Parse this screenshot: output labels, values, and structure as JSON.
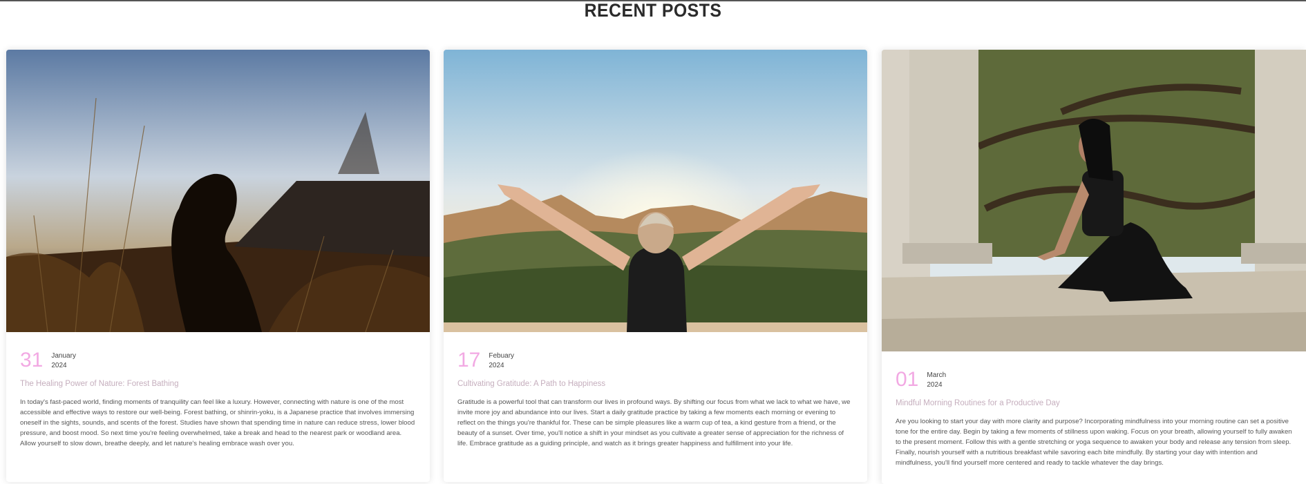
{
  "section": {
    "title": "RECENT POSTS"
  },
  "posts": [
    {
      "day": "31",
      "month": "January",
      "year": "2024",
      "title": "The Healing Power of Nature: Forest Bathing",
      "excerpt": "In today's fast-paced world, finding moments of tranquility can feel like a luxury. However, connecting with nature is one of the most accessible and effective ways to restore our well-being. Forest bathing, or shinrin-yoku, is a Japanese practice that involves immersing oneself in the sights, sounds, and scents of the forest. Studies have shown that spending time in nature can reduce stress, lower blood pressure, and boost mood. So next time you're feeling overwhelmed, take a break and head to the nearest park or woodland area. Allow yourself to slow down, breathe deeply, and let nature's healing embrace wash over you.",
      "image": "man-meditating-in-tall-grass-photo"
    },
    {
      "day": "17",
      "month": "Febuary",
      "year": "2024",
      "title": "Cultivating Gratitude: A Path to Happiness",
      "excerpt": "Gratitude is a powerful tool that can transform our lives in profound ways. By shifting our focus from what we lack to what we have, we invite more joy and abundance into our lives. Start a daily gratitude practice by taking a few moments each morning or evening to reflect on the things you're thankful for. These can be simple pleasures like a warm cup of tea, a kind gesture from a friend, or the beauty of a sunset. Over time, you'll notice a shift in your mindset as you cultivate a greater sense of appreciation for the richness of life. Embrace gratitude as a guiding principle, and watch as it brings greater happiness and fulfillment into your life.",
      "image": "woman-arms-raised-desert-mountains-photo"
    },
    {
      "day": "01",
      "month": "March",
      "year": "2024",
      "title": "Mindful Morning Routines for a Productive Day",
      "excerpt": "Are you looking to start your day with more clarity and purpose? Incorporating mindfulness into your morning routine can set a positive tone for the entire day. Begin by taking a few moments of stillness upon waking. Focus on your breath, allowing yourself to fully awaken to the present moment. Follow this with a gentle stretching or yoga sequence to awaken your body and release any tension from sleep. Finally, nourish yourself with a nutritious breakfast while savoring each bite mindfully. By starting your day with intention and mindfulness, you'll find yourself more centered and ready to tackle whatever the day brings.",
      "image": "woman-yoga-pose-stone-columns-photo"
    }
  ],
  "colors": {
    "accent": "#f2a9e3",
    "title_muted": "#c5aebd",
    "heading": "#2b2b2b"
  }
}
